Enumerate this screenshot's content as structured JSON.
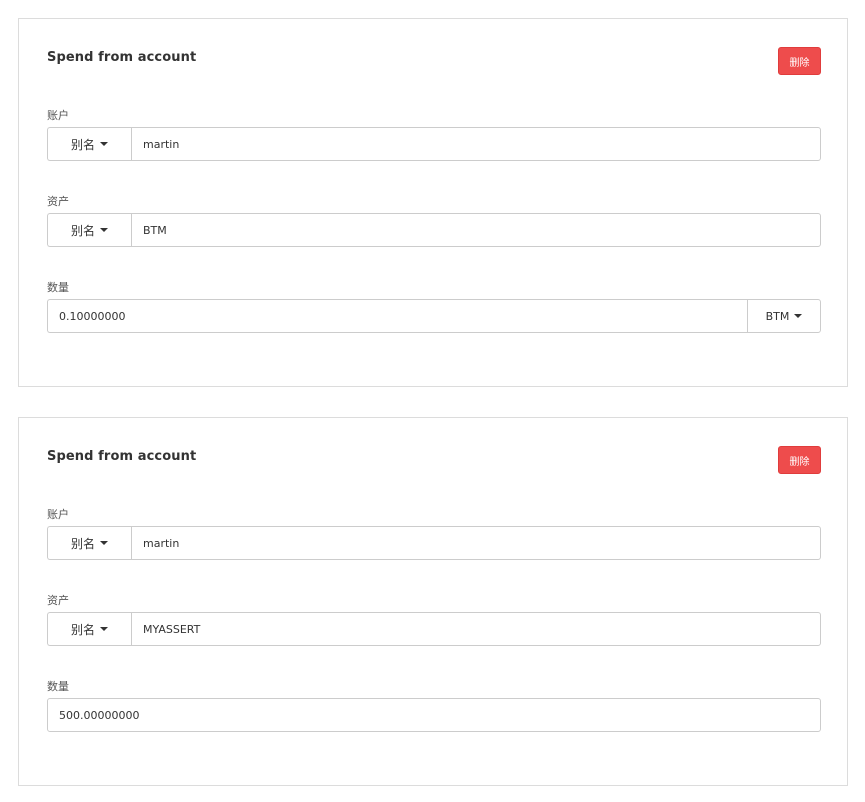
{
  "panels": [
    {
      "title": "Spend from account",
      "delete_label": "删除",
      "account": {
        "label": "账户",
        "mode": "别名",
        "value": "martin"
      },
      "asset": {
        "label": "资产",
        "mode": "别名",
        "value": "BTM"
      },
      "amount": {
        "label": "数量",
        "value": "0.10000000",
        "unit": "BTM"
      }
    },
    {
      "title": "Spend from account",
      "delete_label": "删除",
      "account": {
        "label": "账户",
        "mode": "别名",
        "value": "martin"
      },
      "asset": {
        "label": "资产",
        "mode": "别名",
        "value": "MYASSERT"
      },
      "amount": {
        "label": "数量",
        "value": "500.00000000"
      }
    }
  ],
  "colors": {
    "delete_button": "#ee4c4c",
    "border": "#cccccc",
    "panel_border": "#dcdcdc"
  }
}
